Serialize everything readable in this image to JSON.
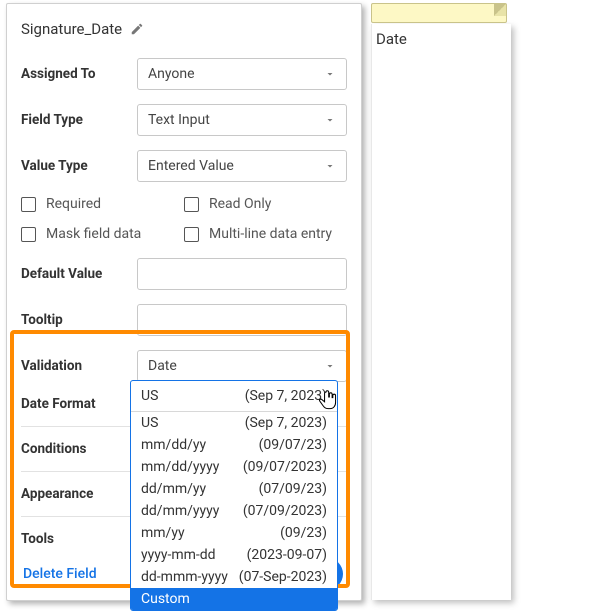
{
  "title": "Signature_Date",
  "fields": {
    "assigned_to": {
      "label": "Assigned To",
      "value": "Anyone"
    },
    "field_type": {
      "label": "Field Type",
      "value": "Text Input"
    },
    "value_type": {
      "label": "Value Type",
      "value": "Entered Value"
    },
    "default_value": {
      "label": "Default Value",
      "value": ""
    },
    "tooltip": {
      "label": "Tooltip",
      "value": ""
    },
    "validation": {
      "label": "Validation",
      "value": "Date"
    },
    "date_format": {
      "label": "Date Format"
    }
  },
  "checkboxes": {
    "required": "Required",
    "read_only": "Read Only",
    "mask": "Mask field data",
    "multiline": "Multi-line data entry"
  },
  "sections": {
    "conditions": "Conditions",
    "appearance": "Appearance",
    "tools": "Tools"
  },
  "delete_link": "Delete Field",
  "side_label": "Date",
  "date_format_dropdown": {
    "selected": {
      "fmt": "US",
      "example": "(Sep 7, 2023)"
    },
    "options": [
      {
        "fmt": "US",
        "example": "(Sep 7, 2023)"
      },
      {
        "fmt": "mm/dd/yy",
        "example": "(09/07/23)"
      },
      {
        "fmt": "mm/dd/yyyy",
        "example": "(09/07/2023)"
      },
      {
        "fmt": "dd/mm/yy",
        "example": "(07/09/23)"
      },
      {
        "fmt": "dd/mm/yyyy",
        "example": "(07/09/2023)"
      },
      {
        "fmt": "mm/yy",
        "example": "(09/23)"
      },
      {
        "fmt": "yyyy-mm-dd",
        "example": "(2023-09-07)"
      },
      {
        "fmt": "dd-mmm-yyyy",
        "example": "(07-Sep-2023)"
      },
      {
        "fmt": "Custom",
        "example": ""
      }
    ],
    "highlighted_index": 8
  }
}
